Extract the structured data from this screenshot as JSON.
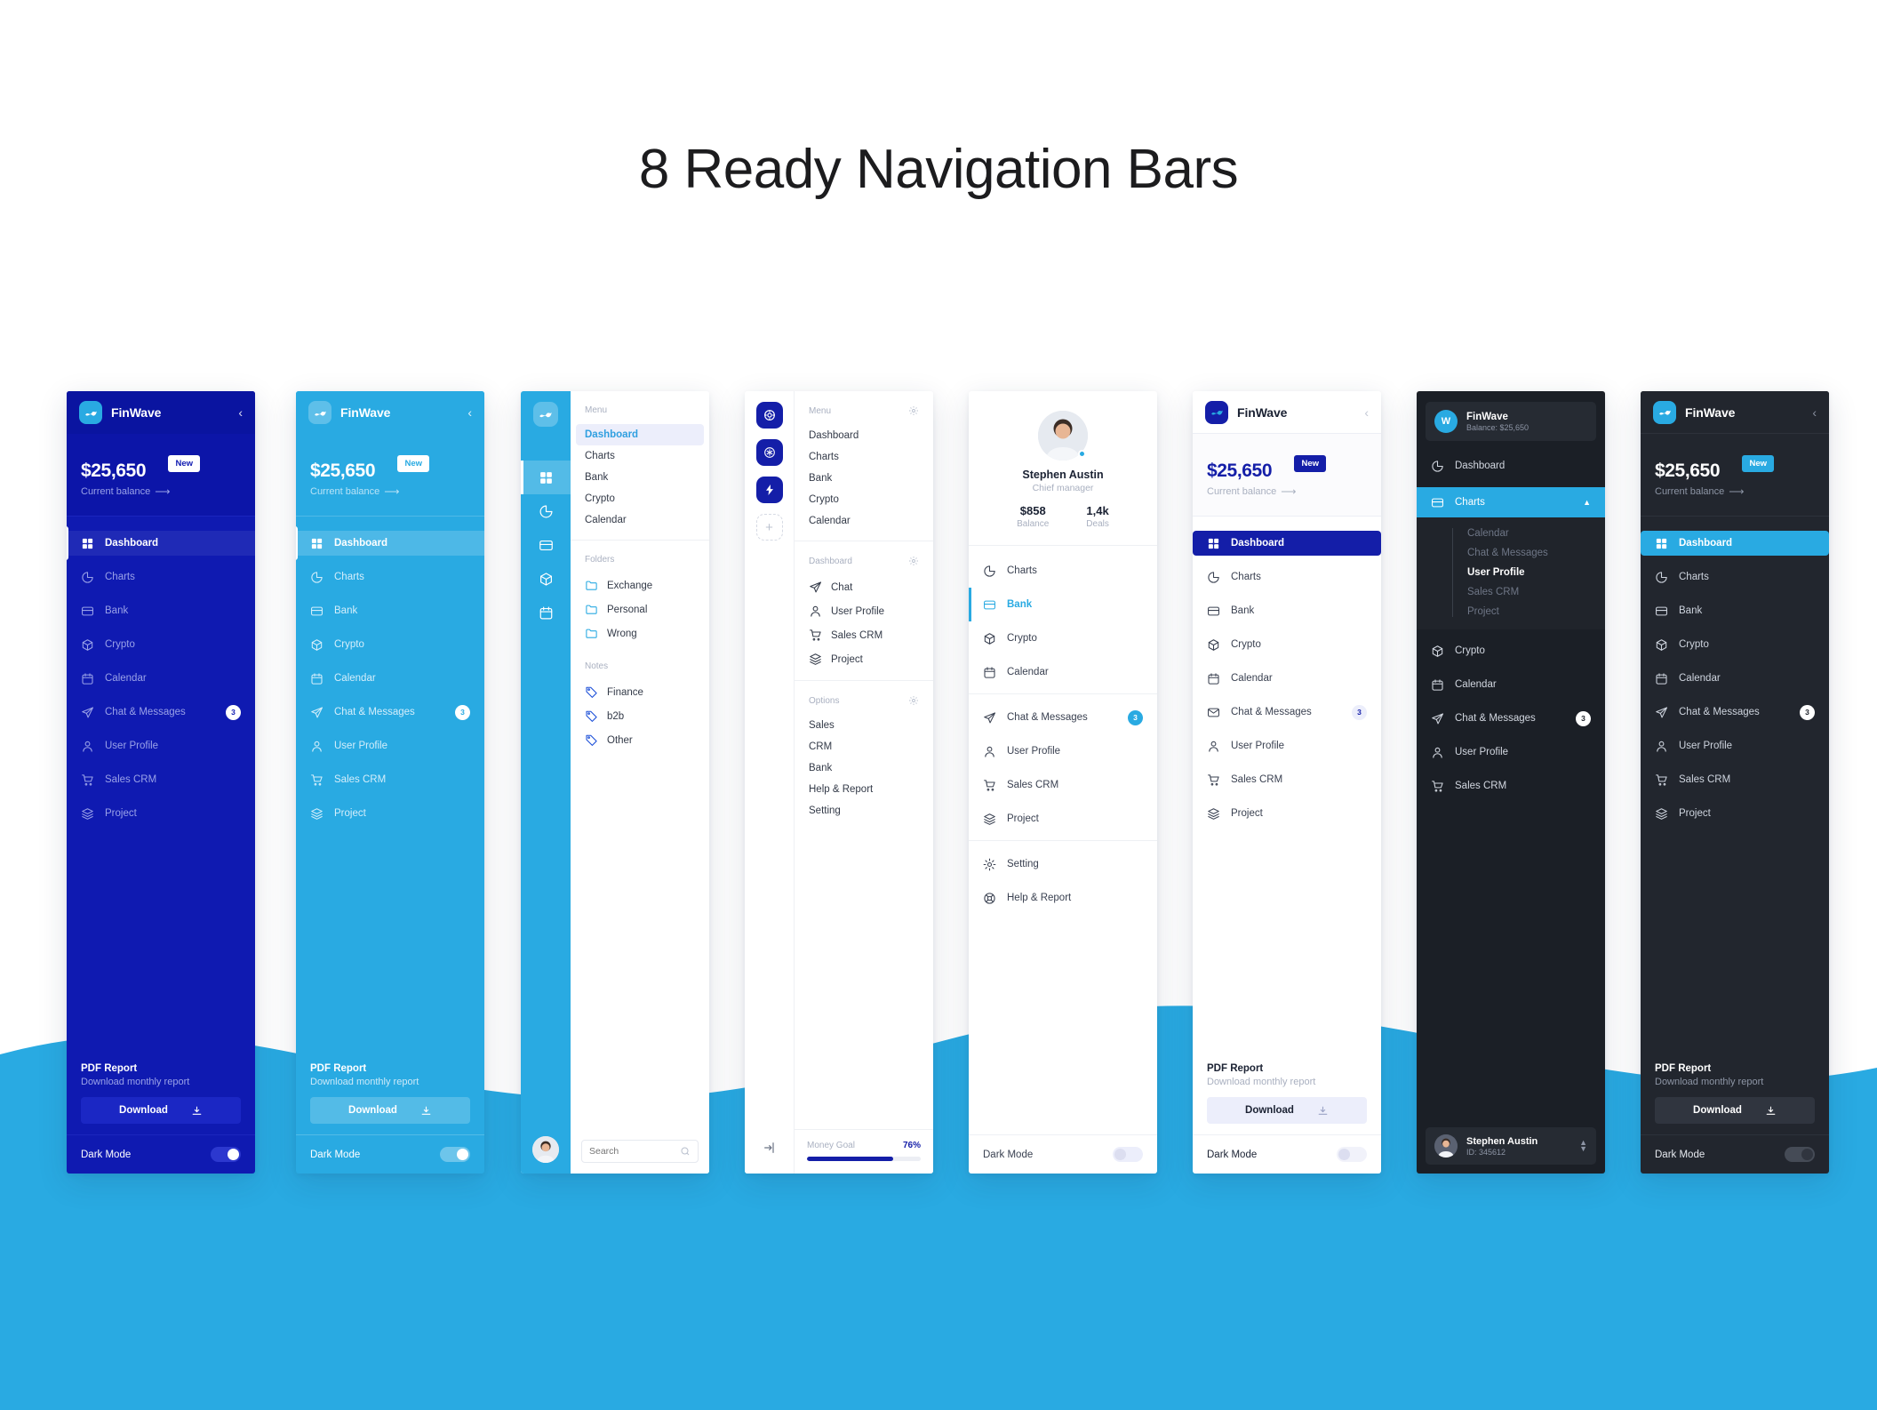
{
  "page": {
    "title": "8 Ready Navigation Bars"
  },
  "brand": {
    "name": "FinWave"
  },
  "common": {
    "balance_amount": "$25,650",
    "balance_caption": "Current balance",
    "badge_new": "New",
    "promo_title": "PDF Report",
    "promo_subtitle": "Download monthly report",
    "promo_button": "Download",
    "dark_mode": "Dark Mode",
    "badge_count": "3"
  },
  "nav_full": [
    {
      "label": "Dashboard",
      "icon": "grid-icon",
      "active": true
    },
    {
      "label": "Charts",
      "icon": "pie-chart-icon",
      "active": false
    },
    {
      "label": "Bank",
      "icon": "card-icon",
      "active": false
    },
    {
      "label": "Crypto",
      "icon": "cube-icon",
      "active": false
    },
    {
      "label": "Calendar",
      "icon": "calendar-icon",
      "active": false
    },
    {
      "label": "Chat & Messages",
      "icon": "send-icon",
      "active": false,
      "badge": "3"
    },
    {
      "label": "User Profile",
      "icon": "user-icon",
      "active": false
    },
    {
      "label": "Sales CRM",
      "icon": "cart-icon",
      "active": false
    },
    {
      "label": "Project",
      "icon": "layers-icon",
      "active": false
    }
  ],
  "panel3": {
    "rail_items": [
      "grid-icon",
      "pie-chart-icon",
      "card-icon",
      "cube-icon",
      "calendar-icon"
    ],
    "menu_heading": "Menu",
    "menu": [
      {
        "label": "Dashboard",
        "active": true
      },
      {
        "label": "Charts",
        "active": false
      },
      {
        "label": "Bank",
        "active": false
      },
      {
        "label": "Crypto",
        "active": false
      },
      {
        "label": "Calendar",
        "active": false
      }
    ],
    "folders_heading": "Folders",
    "folders": [
      {
        "label": "Exchange",
        "icon": "folder-icon"
      },
      {
        "label": "Personal",
        "icon": "folder-icon"
      },
      {
        "label": "Wrong",
        "icon": "folder-icon"
      }
    ],
    "notes_heading": "Notes",
    "notes": [
      {
        "label": "Finance",
        "icon": "tag-icon"
      },
      {
        "label": "b2b",
        "icon": "tag-icon"
      },
      {
        "label": "Other",
        "icon": "tag-icon"
      }
    ],
    "search_placeholder": "Search"
  },
  "panel4": {
    "rail_items": [
      "lifebuoy-icon",
      "snowflake-icon",
      "bolt-icon",
      "plus-icon"
    ],
    "menu_heading": "Menu",
    "menu": [
      "Dashboard",
      "Charts",
      "Bank",
      "Crypto",
      "Calendar"
    ],
    "dashboard_heading": "Dashboard",
    "dashboard": [
      {
        "label": "Chat",
        "icon": "send-icon"
      },
      {
        "label": "User Profile",
        "icon": "user-icon"
      },
      {
        "label": "Sales CRM",
        "icon": "cart-icon"
      },
      {
        "label": "Project",
        "icon": "layers-icon"
      }
    ],
    "options_heading": "Options",
    "options": [
      "Sales",
      "CRM",
      "Bank",
      "Help & Report",
      "Setting"
    ],
    "goal_label": "Money Goal",
    "goal_percent": "76%",
    "goal_value": 76
  },
  "panel5": {
    "user_name": "Stephen Austin",
    "user_role": "Chief manager",
    "stat_balance_value": "$858",
    "stat_balance_label": "Balance",
    "stat_deals_value": "1,4k",
    "stat_deals_label": "Deals",
    "group1": [
      {
        "label": "Charts",
        "icon": "pie-chart-icon",
        "active": false
      },
      {
        "label": "Bank",
        "icon": "card-icon",
        "active": true
      },
      {
        "label": "Crypto",
        "icon": "cube-icon",
        "active": false
      },
      {
        "label": "Calendar",
        "icon": "calendar-icon",
        "active": false
      }
    ],
    "group2": [
      {
        "label": "Chat & Messages",
        "icon": "send-icon",
        "badge": "3"
      },
      {
        "label": "User Profile",
        "icon": "user-icon"
      },
      {
        "label": "Sales CRM",
        "icon": "cart-icon"
      },
      {
        "label": "Project",
        "icon": "layers-icon"
      }
    ],
    "group3": [
      {
        "label": "Setting",
        "icon": "gear-icon"
      },
      {
        "label": "Help & Report",
        "icon": "help-icon"
      }
    ],
    "dark_mode": "Dark Mode"
  },
  "panel6": {
    "nav": [
      {
        "label": "Dashboard",
        "icon": "grid-icon",
        "active": true
      },
      {
        "label": "Charts",
        "icon": "pie-chart-icon"
      },
      {
        "label": "Bank",
        "icon": "card-icon"
      },
      {
        "label": "Crypto",
        "icon": "cube-icon"
      },
      {
        "label": "Calendar",
        "icon": "calendar-icon"
      },
      {
        "label": "Chat & Messages",
        "icon": "mail-icon",
        "badge": "3"
      },
      {
        "label": "User Profile",
        "icon": "user-icon"
      },
      {
        "label": "Sales CRM",
        "icon": "cart-icon"
      },
      {
        "label": "Project",
        "icon": "layers-icon"
      }
    ]
  },
  "panel7": {
    "account_initial": "W",
    "account_name": "FinWave",
    "account_sub": "Balance: $25,650",
    "nav": [
      {
        "label": "Dashboard",
        "icon": "pie-chart-icon",
        "active": false
      },
      {
        "label": "Charts",
        "icon": "card-icon",
        "active": true
      }
    ],
    "submenu": [
      {
        "label": "Calendar",
        "on": false
      },
      {
        "label": "Chat & Messages",
        "on": false
      },
      {
        "label": "User Profile",
        "on": true
      },
      {
        "label": "Sales CRM",
        "on": false
      },
      {
        "label": "Project",
        "on": false
      }
    ],
    "nav_rest": [
      {
        "label": "Crypto",
        "icon": "cube-icon"
      },
      {
        "label": "Calendar",
        "icon": "calendar-icon"
      },
      {
        "label": "Chat & Messages",
        "icon": "send-icon",
        "badge": "3"
      },
      {
        "label": "User Profile",
        "icon": "user-icon"
      },
      {
        "label": "Sales CRM",
        "icon": "cart-icon"
      }
    ],
    "footer_name": "Stephen Austin",
    "footer_id": "ID: 345612"
  },
  "colors": {
    "deep_blue": "#0f1ab1",
    "navy": "#141ea8",
    "sky": "#29aae2",
    "dark": "#22262e",
    "dark_alt": "#1b1f26"
  }
}
